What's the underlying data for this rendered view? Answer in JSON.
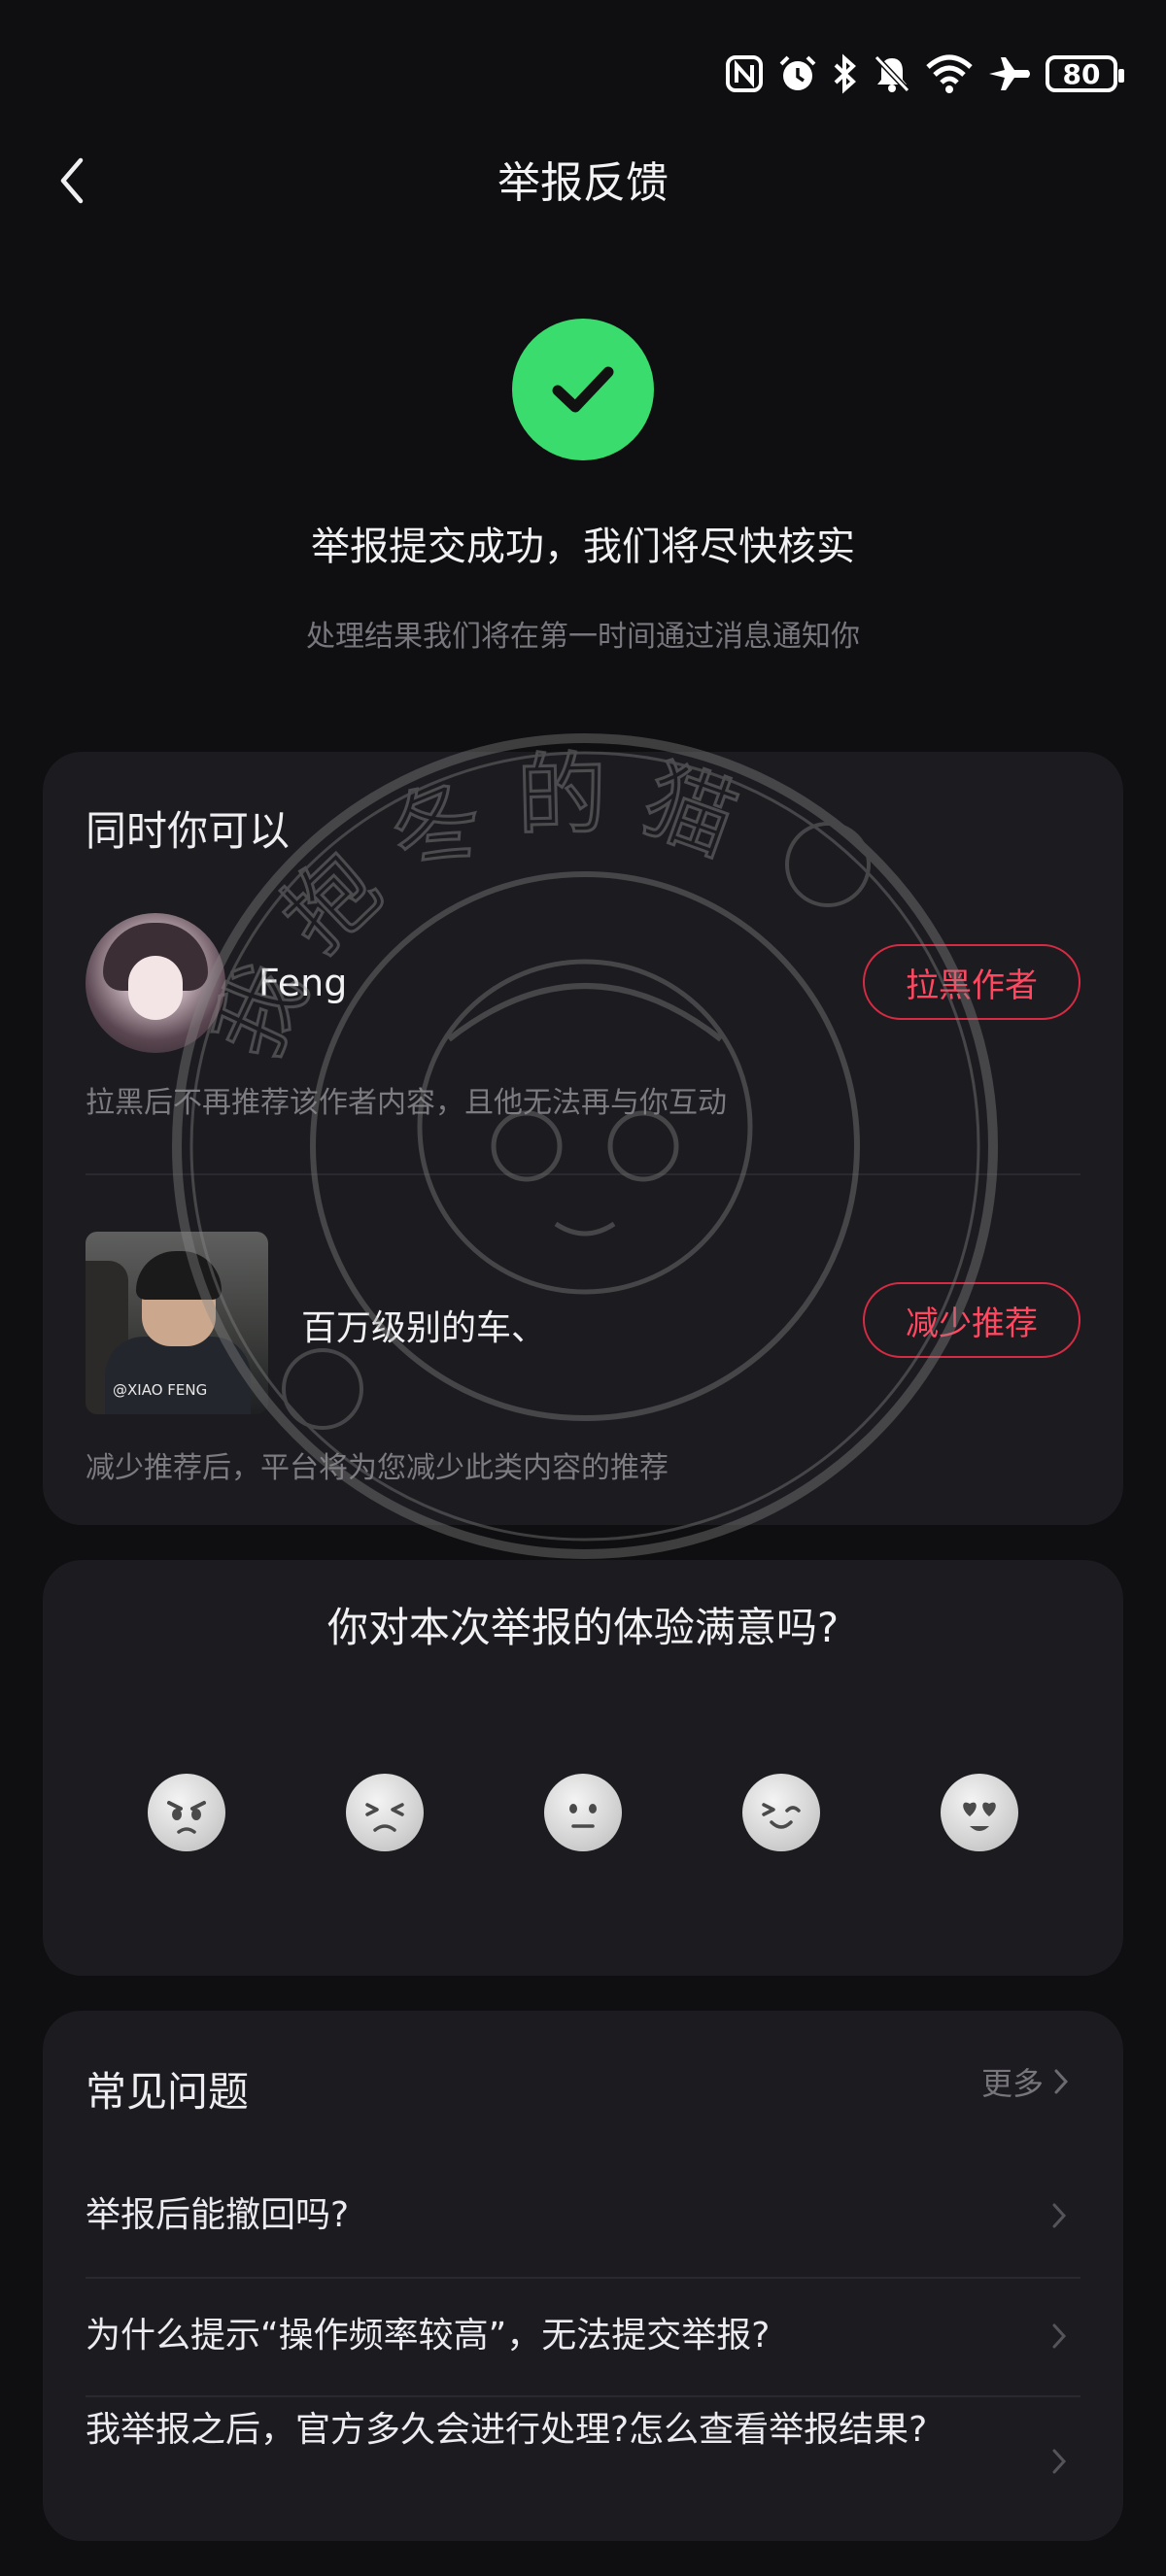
{
  "status_bar": {
    "battery": "80",
    "icons": [
      "nfc-icon",
      "alarm-icon",
      "bluetooth-icon",
      "mute-icon",
      "wifi-icon",
      "airplane-icon",
      "battery-icon"
    ]
  },
  "header": {
    "back_icon": "back-chevron-icon",
    "title": "举报反馈"
  },
  "success": {
    "icon": "check-circle-icon",
    "title": "举报提交成功，我们将尽快核实",
    "subtitle": "处理结果我们将在第一时间通过消息通知你"
  },
  "actions": {
    "title": "同时你可以",
    "block": {
      "user_name": "Feng",
      "button": "拉黑作者",
      "desc": "拉黑后不再推荐该作者内容，且他无法再与你互动"
    },
    "reduce": {
      "video_title": "百万级别的车、",
      "thumb_watermark": "@XIAO FENG",
      "button": "减少推荐",
      "desc": "减少推荐后，平台将为您减少此类内容的推荐"
    }
  },
  "survey": {
    "question": "你对本次举报的体验满意吗?",
    "faces": [
      "angry-face-icon",
      "sad-face-icon",
      "neutral-face-icon",
      "smile-face-icon",
      "love-face-icon"
    ]
  },
  "faq": {
    "title": "常见问题",
    "more": "更多",
    "items": [
      "举报后能撤回吗?",
      "为什么提示“操作频率较高”，无法提交举报?",
      "我举报之后，官方多久会进行处理?怎么查看举报结果?"
    ]
  },
  "watermark": {
    "text": "我抱冬的猫"
  },
  "colors": {
    "background": "#0f0f11",
    "card": "#1c1b20",
    "success_green": "#3adc6e",
    "accent_red": "#ff4760"
  }
}
